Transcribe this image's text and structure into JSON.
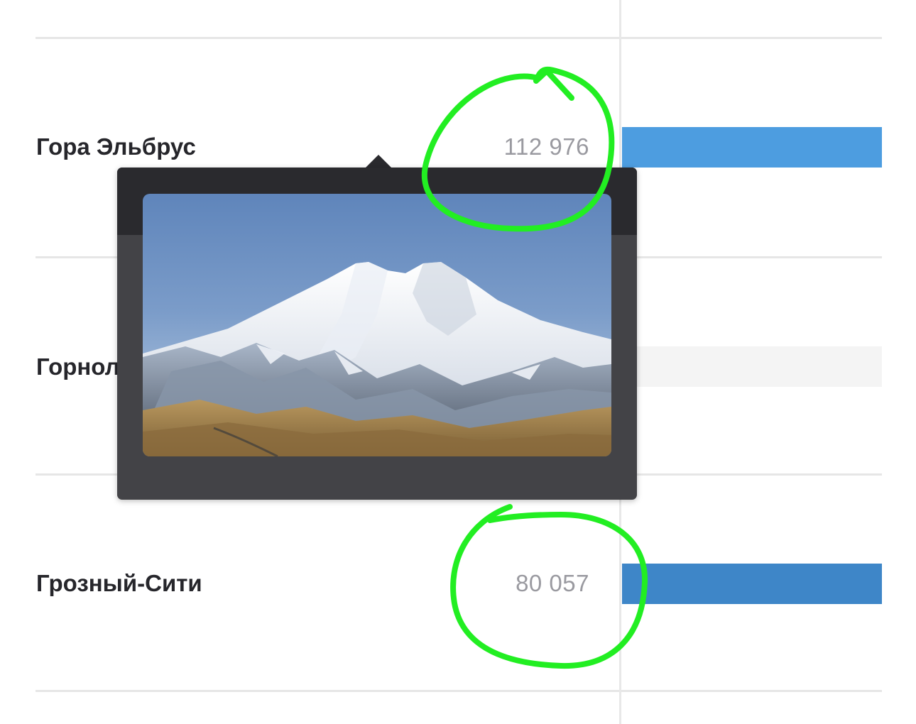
{
  "rows": [
    {
      "name": "Гора Эльбрус",
      "count": "112 976",
      "bar_fraction": 1.0,
      "bar_color": "#4d9de0"
    },
    {
      "name": "Горнолы",
      "count": "",
      "bar_fraction": 0.05,
      "bar_color": "#24344a"
    },
    {
      "name": "Грозный-Сити",
      "count": "80 057",
      "bar_fraction": 1.0,
      "bar_color": "#3e86c8"
    }
  ],
  "popover": {
    "image_subject": "mount-elbrus-photo"
  },
  "annotations": {
    "color": "#22ee22",
    "type": "hand-drawn-circles"
  }
}
